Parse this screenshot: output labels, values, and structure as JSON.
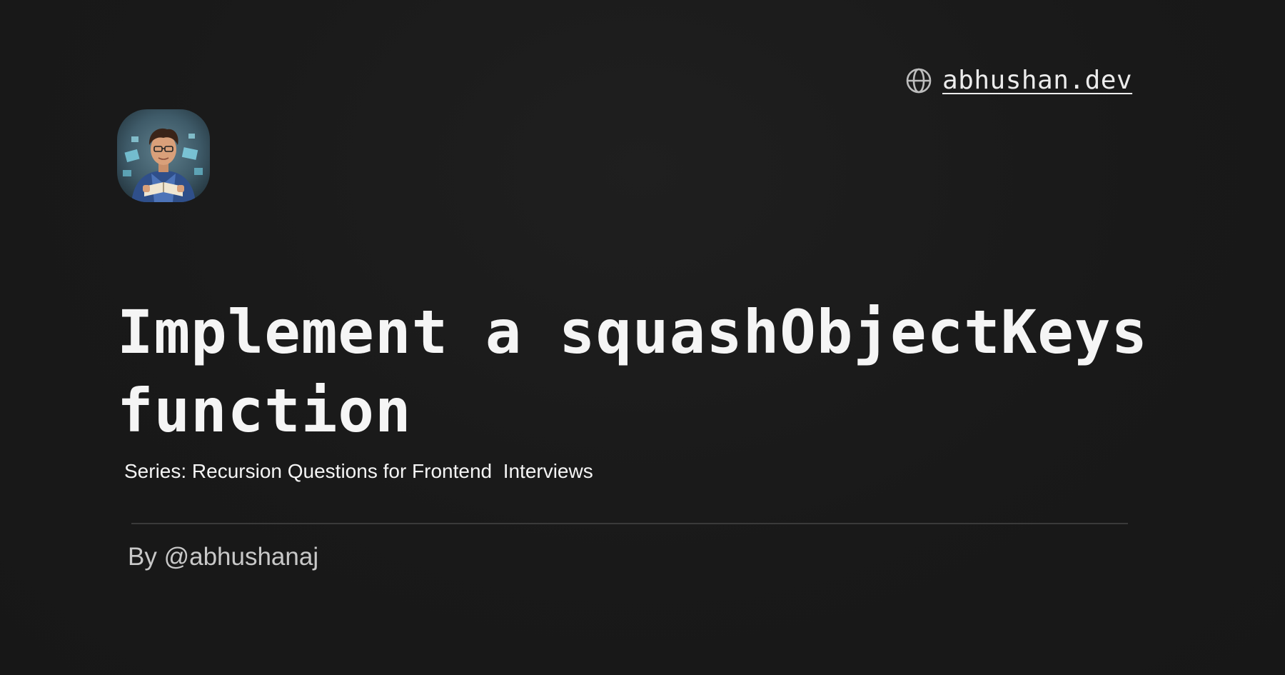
{
  "site": {
    "url_text": "abhushan.dev",
    "icon": "globe-icon"
  },
  "avatar": {
    "icon": "author-avatar"
  },
  "post": {
    "title": "Implement a squashObjectKeys function",
    "series": "Series: Recursion Questions for Frontend  Interviews",
    "byline": "By @abhushanaj"
  },
  "colors": {
    "background": "#191919",
    "text": "#f5f5f5",
    "muted": "#c8c8c8",
    "divider": "#3a3a3a"
  }
}
